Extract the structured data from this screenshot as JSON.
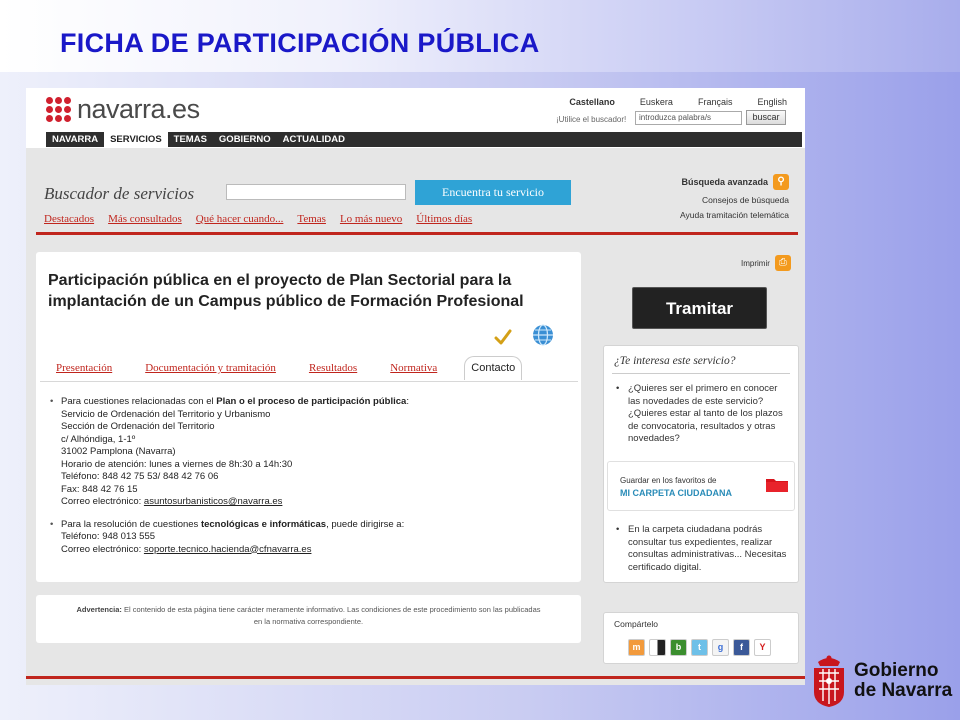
{
  "slide": {
    "title": "FICHA DE PARTICIPACIÓN PÚBLICA",
    "footer_logo_line1": "Gobierno",
    "footer_logo_line2": "de Navarra"
  },
  "header": {
    "logo_text": "navarra.es",
    "languages": [
      "Castellano",
      "Euskera",
      "Français",
      "English"
    ],
    "active_language": "Castellano",
    "search_hint": "¡Utilice el buscador!",
    "search_placeholder": "introduzca palabra/s",
    "search_button": "buscar"
  },
  "nav": {
    "items": [
      "NAVARRA",
      "SERVICIOS",
      "TEMAS",
      "GOBIERNO",
      "ACTUALIDAD"
    ],
    "active": "SERVICIOS"
  },
  "buscador": {
    "title": "Buscador de servicios",
    "button": "Encuentra tu servicio",
    "links": [
      "Destacados",
      "Más consultados",
      "Qué hacer cuando...",
      "Temas",
      "Lo más nuevo",
      "Últimos días"
    ],
    "advanced": "Búsqueda avanzada",
    "advice": "Consejos de búsqueda",
    "help": "Ayuda tramitación telemática"
  },
  "content": {
    "heading": "Participación pública en el proyecto de Plan Sectorial para la implantación de un Campus público de Formación Profesional",
    "tabs": [
      "Presentación",
      "Documentación y tramitación",
      "Resultados",
      "Normativa",
      "Contacto"
    ],
    "active_tab": "Contacto",
    "contact1": {
      "intro_prefix": "Para cuestiones relacionadas con el ",
      "intro_bold": "Plan o el proceso de participación pública",
      "intro_suffix": ":",
      "lines": [
        "Servicio de Ordenación del Territorio y Urbanismo",
        "Sección de Ordenación del Territorio",
        "c/ Alhóndiga, 1-1º",
        "31002 Pamplona (Navarra)",
        "Horario de atención: lunes a viernes de 8h:30 a 14h:30",
        "Teléfono: 848 42 75 53/ 848 42 76 06",
        "Fax: 848 42 76 15"
      ],
      "email_label": "Correo electrónico: ",
      "email": "asuntosurbanisticos@navarra.es"
    },
    "contact2": {
      "intro_prefix": "Para la resolución de cuestiones ",
      "intro_bold": "tecnológicas e informáticas",
      "intro_suffix": ", puede dirigirse a:",
      "phone": "Teléfono: 948 013 555",
      "email_label": "Correo electrónico: ",
      "email": "soporte.tecnico.hacienda@cfnavarra.es"
    },
    "warning_bold": "Advertencia:",
    "warning_text": " El contenido de esta página tiene carácter meramente informativo. Las condiciones de este procedimiento son las publicadas en la normativa correspondiente."
  },
  "sidebar": {
    "print": "Imprimir",
    "tramitar": "Tramitar",
    "interest_title": "¿Te interesa este servicio?",
    "interest_text": "¿Quieres ser el primero en conocer las novedades de este servicio? ¿Quieres estar al tanto de los plazos de convocatoria, resultados y otras novedades?",
    "favorites_small": "Guardar en los favoritos de",
    "favorites_big": "MI CARPETA CIUDADANA",
    "carpeta_text": "En la carpeta ciudadana podrás consultar tus expedientes, realizar consultas administrativas... Necesitas certificado digital.",
    "share_title": "Compártelo",
    "share_icons": [
      "meneame-icon",
      "delicious-icon",
      "bitacoras-icon",
      "twitter-icon",
      "google-icon",
      "facebook-icon",
      "yahoo-icon"
    ]
  }
}
